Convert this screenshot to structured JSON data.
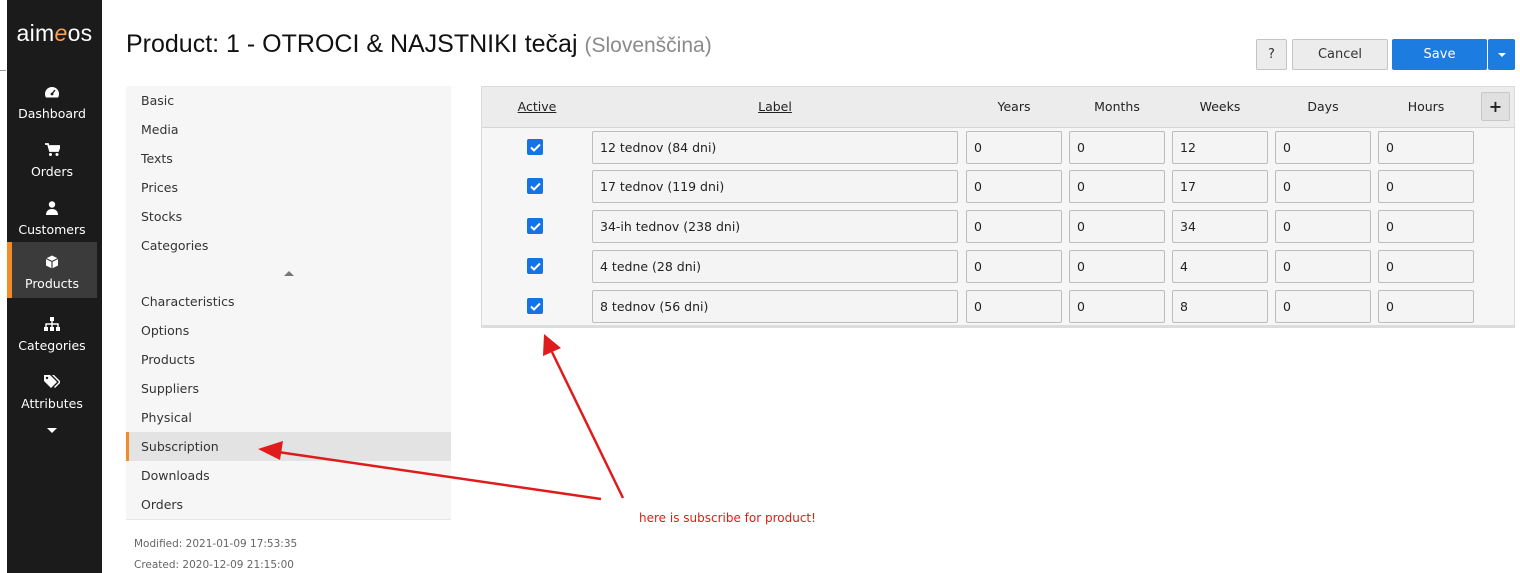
{
  "app": {
    "logo_a": "aim",
    "logo_e": "e",
    "logo_b": "os"
  },
  "sidebar": {
    "items": [
      {
        "label": "Dashboard",
        "icon": "dashboard-icon"
      },
      {
        "label": "Orders",
        "icon": "cart-icon"
      },
      {
        "label": "Customers",
        "icon": "user-icon"
      },
      {
        "label": "Products",
        "icon": "box-icon",
        "active": true
      },
      {
        "label": "Categories",
        "icon": "sitemap-icon"
      },
      {
        "label": "Attributes",
        "icon": "tags-icon"
      }
    ],
    "more_icon": "caret-down-icon"
  },
  "header": {
    "title": "Product: 1 - OTROCI & NAJSTNIKI tečaj",
    "language": "(Slovenščina)",
    "help_label": "?",
    "cancel_label": "Cancel",
    "save_label": "Save"
  },
  "subnav": {
    "items_top": [
      "Basic",
      "Media",
      "Texts",
      "Prices",
      "Stocks",
      "Categories"
    ],
    "items_bottom": [
      "Characteristics",
      "Options",
      "Products",
      "Suppliers",
      "Physical",
      "Subscription",
      "Downloads",
      "Orders"
    ],
    "active": "Subscription",
    "modified": "Modified: 2021-01-09 17:53:35",
    "created": "Created: 2020-12-09 21:15:00"
  },
  "table": {
    "headers": [
      "Active",
      "Label",
      "Years",
      "Months",
      "Weeks",
      "Days",
      "Hours"
    ],
    "add_label": "+",
    "rows": [
      {
        "active": true,
        "label": "12 tednov (84 dni)",
        "years": "0",
        "months": "0",
        "weeks": "12",
        "days": "0",
        "hours": "0"
      },
      {
        "active": true,
        "label": "17 tednov (119 dni)",
        "years": "0",
        "months": "0",
        "weeks": "17",
        "days": "0",
        "hours": "0"
      },
      {
        "active": true,
        "label": "34-ih tednov (238 dni)",
        "years": "0",
        "months": "0",
        "weeks": "34",
        "days": "0",
        "hours": "0"
      },
      {
        "active": true,
        "label": "4 tedne (28 dni)",
        "years": "0",
        "months": "0",
        "weeks": "4",
        "days": "0",
        "hours": "0"
      },
      {
        "active": true,
        "label": "8 tednov (56 dni)",
        "years": "0",
        "months": "0",
        "weeks": "8",
        "days": "0",
        "hours": "0"
      }
    ]
  },
  "annotation": {
    "text": "here is subscribe for product!",
    "color": "#e01b1b"
  },
  "colors": {
    "accent": "#f48b2a",
    "primary": "#1d7ce0",
    "sidebar_bg": "#1b1b1b"
  }
}
